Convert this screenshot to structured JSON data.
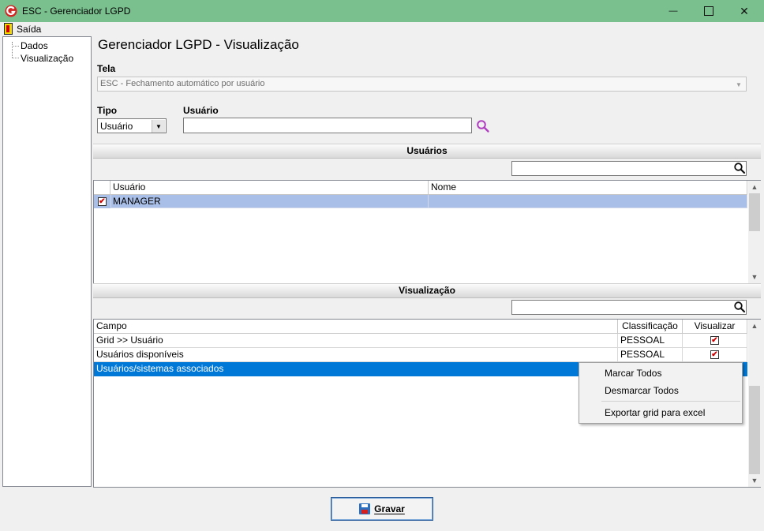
{
  "window": {
    "title": "ESC - Gerenciador LGPD",
    "minimize": "—",
    "maximize": "☐",
    "close": "✕"
  },
  "menu": {
    "exit_label": "Saída"
  },
  "tree": {
    "items": [
      "Dados",
      "Visualização"
    ]
  },
  "page": {
    "title": "Gerenciador LGPD - Visualização"
  },
  "form": {
    "tela_label": "Tela",
    "tela_value": "ESC - Fechamento automático por usuário",
    "tipo_label": "Tipo",
    "tipo_value": "Usuário",
    "usuario_label": "Usuário",
    "usuario_value": ""
  },
  "usuarios_section": {
    "title": "Usuários",
    "filter_value": "",
    "columns": [
      "Usuário",
      "Nome"
    ],
    "rows": [
      {
        "checked": true,
        "usuario": "MANAGER",
        "nome": ""
      }
    ]
  },
  "visualizacao_section": {
    "title": "Visualização",
    "filter_value": "",
    "columns": [
      "Campo",
      "Classificação",
      "Visualizar"
    ],
    "rows": [
      {
        "campo": "Grid >> Usuário",
        "classificacao": "PESSOAL",
        "visualizar": true
      },
      {
        "campo": "Usuários disponíveis",
        "classificacao": "PESSOAL",
        "visualizar": true
      },
      {
        "campo": "Usuários/sistemas associados",
        "classificacao": "",
        "visualizar": false
      }
    ]
  },
  "context_menu": {
    "items": [
      "Marcar Todos",
      "Desmarcar Todos",
      "Exportar grid para excel"
    ]
  },
  "buttons": {
    "save_label": "Gravar"
  },
  "colors": {
    "titlebar": "#7ac08e",
    "selection": "#0078d7",
    "row_highlight": "#a9bfe8",
    "search_icon_accent": "#b040c0"
  }
}
